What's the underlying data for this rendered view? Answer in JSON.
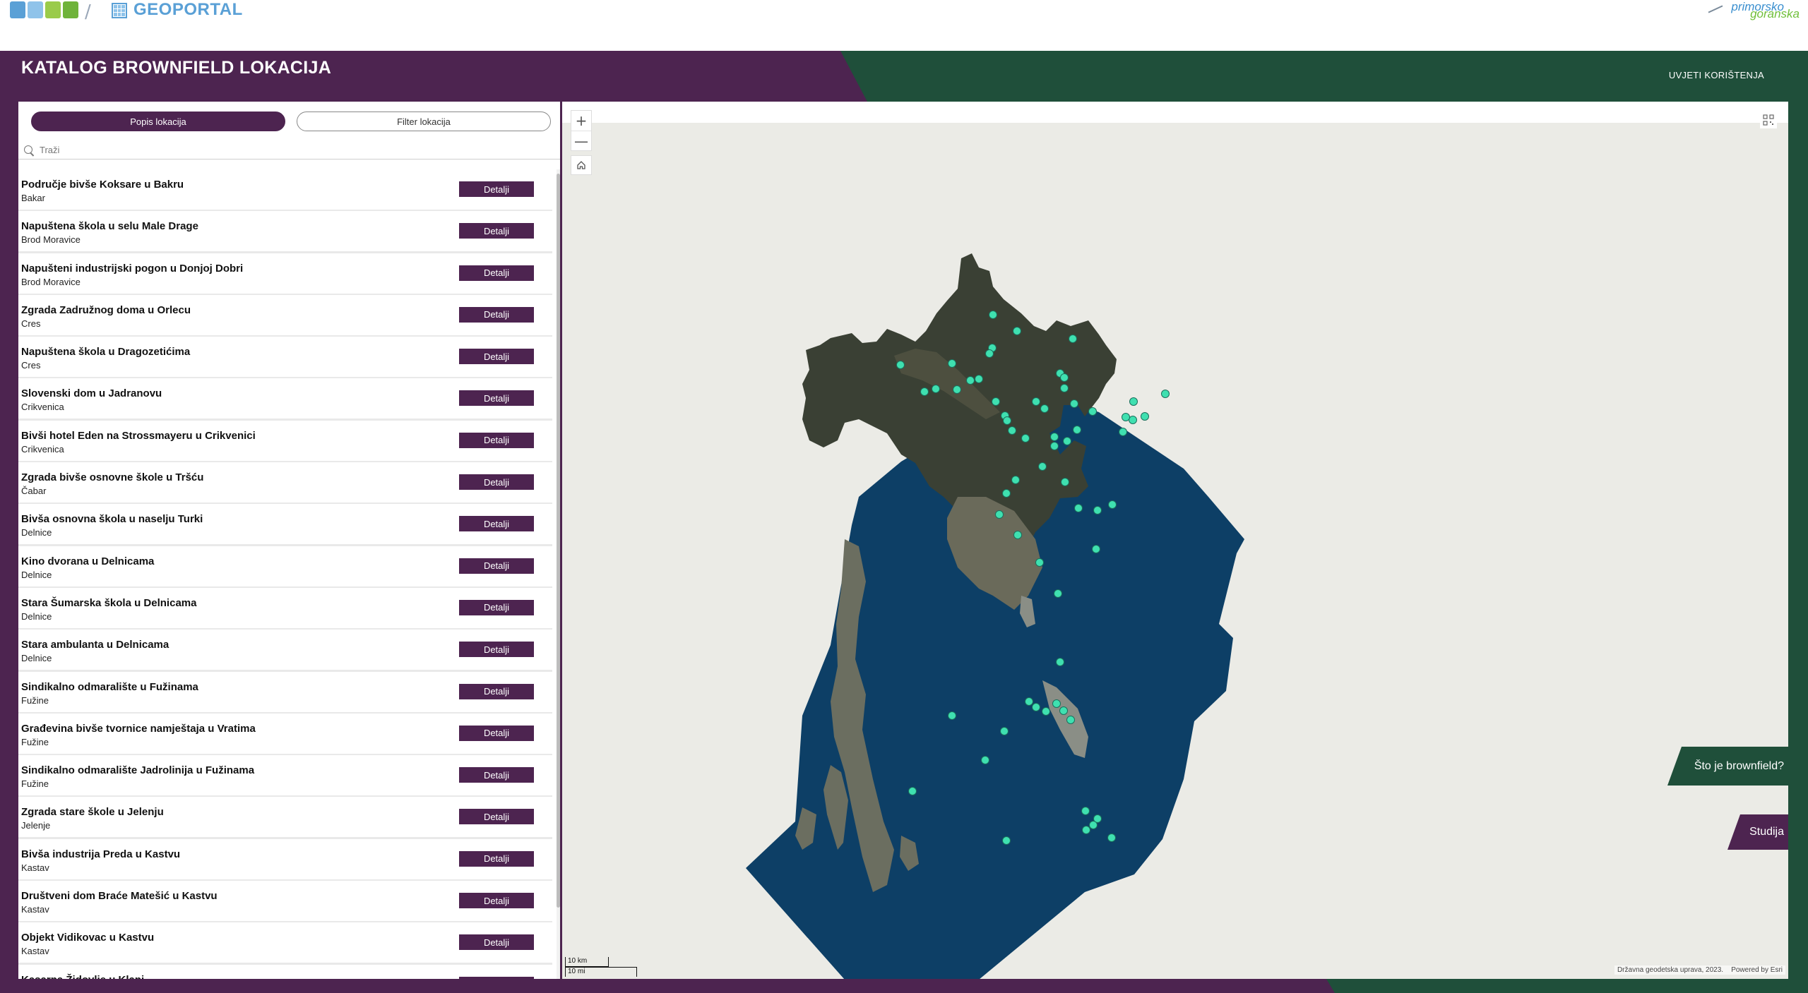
{
  "header": {
    "zzpu_logo_letters": "ZZPU",
    "geoportal_label": "GEOPORTAL",
    "pgz_logo_line1": "primorsko",
    "pgz_logo_line2": "goranska"
  },
  "banner": {
    "title": "KATALOG BROWNFIELD LOKACIJA",
    "terms_link": "UVJETI KORIŠTENJA"
  },
  "panel": {
    "tabs": [
      {
        "label": "Popis lokacija",
        "active": true
      },
      {
        "label": "Filter lokacija",
        "active": false
      }
    ],
    "search_placeholder": "Traži",
    "detail_label": "Detalji",
    "items": [
      {
        "title": "Područje bivše Koksare u Bakru",
        "place": "Bakar"
      },
      {
        "title": "Napuštena škola u selu Male Drage",
        "place": "Brod Moravice"
      },
      {
        "title": "Napušteni industrijski pogon u Donjoj Dobri",
        "place": "Brod Moravice"
      },
      {
        "title": "Zgrada Zadružnog doma u Orlecu",
        "place": "Cres"
      },
      {
        "title": "Napuštena škola u Dragozetićima",
        "place": "Cres"
      },
      {
        "title": "Slovenski dom u Jadranovu",
        "place": "Crikvenica"
      },
      {
        "title": "Bivši hotel Eden na Strossmayeru u Crikvenici",
        "place": "Crikvenica"
      },
      {
        "title": "Zgrada bivše osnovne škole u Tršću",
        "place": "Čabar"
      },
      {
        "title": "Bivša osnovna škola u naselju Turki",
        "place": "Delnice"
      },
      {
        "title": "Kino dvorana u Delnicama",
        "place": "Delnice"
      },
      {
        "title": "Stara Šumarska škola u Delnicama",
        "place": "Delnice"
      },
      {
        "title": "Stara ambulanta u Delnicama",
        "place": "Delnice"
      },
      {
        "title": "Sindikalno odmaralište u Fužinama",
        "place": "Fužine"
      },
      {
        "title": "Građevina bivše tvornice namještaja u Vratima",
        "place": "Fužine"
      },
      {
        "title": "Sindikalno odmaralište Jadrolinija u Fužinama",
        "place": "Fužine"
      },
      {
        "title": "Zgrada stare škole u Jelenju",
        "place": "Jelenje"
      },
      {
        "title": "Bivša industrija Preda u Kastvu",
        "place": "Kastav"
      },
      {
        "title": "Društveni dom Braće Matešić u Kastvu",
        "place": "Kastav"
      },
      {
        "title": "Objekt Vidikovac u Kastvu",
        "place": "Kastav"
      },
      {
        "title": "Kasarna Židovlje u Klani",
        "place": ""
      }
    ]
  },
  "map": {
    "zoom_in": "+",
    "zoom_out": "—",
    "scale_km": "10 km",
    "scale_mi": "10 mi",
    "attribution": "Državna geodetska uprava, 2023.",
    "powered_by": "Powered by Esri",
    "icons": [
      "home-icon",
      "qr-code-icon"
    ],
    "colors": {
      "sea": "#0d3f66",
      "land": "#3a4034",
      "marker": "#3fe0b0",
      "background": "#ebebe6"
    }
  },
  "side_buttons": {
    "what_is_brownfield": "Što je brownfield?",
    "study": "Studija"
  },
  "colors": {
    "brand_purple": "#4d2450",
    "brand_green": "#1f4f3a"
  }
}
